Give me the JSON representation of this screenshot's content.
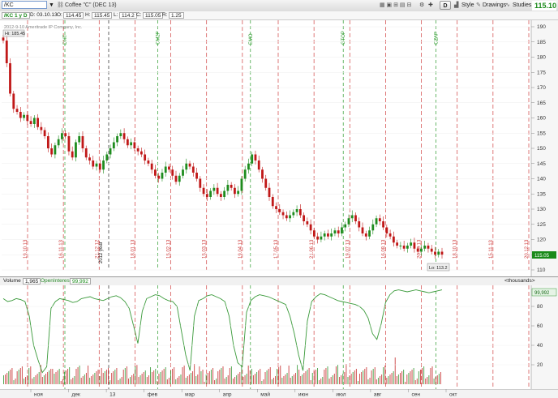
{
  "toolbar": {
    "symbol": "/KC",
    "instrument_name": "Coffee \"C\" (DEC 13)",
    "style_label": "Style",
    "drawings_label": "Drawings",
    "studies_label": "Studies",
    "d_label": "D",
    "last_price": "115.10"
  },
  "infobar": {
    "symbol_badge": "/KC 1 y D",
    "date": "D: 03.10.13",
    "o_label": "O:",
    "o_value": "114.45",
    "h_label": "H:",
    "h_value": "115.45",
    "l_label": "L:",
    "l_value": "114.2",
    "c_label": "C:",
    "c_value": "115.05",
    "r_label": "R:",
    "r_value": "1.25"
  },
  "price_chart": {
    "copyright": "2012-9-10 Ameritrade IP Company, Inc.",
    "high_label": "Hi: 185.45",
    "low_label": "Lo: 113.2",
    "last_label": "115.05",
    "year_marker": "2012 year",
    "y_ticks": [
      "190",
      "185",
      "180",
      "175",
      "170",
      "165",
      "160",
      "155",
      "150",
      "145",
      "140",
      "135",
      "130",
      "125",
      "120",
      "115",
      "110"
    ],
    "red_date_labels": [
      "19.10.13",
      "16.11.13",
      "21.12.12",
      "18.01.13",
      "15.02.13",
      "15.03.13",
      "19.04.13",
      "17.05.13",
      "21.06.13",
      "19.07.13",
      "16.08.13",
      "20.09.13",
      "18.10.13",
      "15.11.13",
      "20.12.13"
    ],
    "green_date_labels": [
      "DHT",
      "CM2P",
      "EMO",
      "GTOP",
      "CZAP"
    ]
  },
  "volume_panel": {
    "volume_label": "Volume",
    "volume_value": "1,965",
    "oi_label": "OpenInterest",
    "oi_value": "99,992",
    "units_label": "<thousands>",
    "oi_last": "99,992",
    "y_ticks": [
      "80",
      "60",
      "40",
      "20"
    ]
  },
  "x_axis": {
    "months": [
      "ноя",
      "дек",
      "13",
      "фев",
      "мар",
      "апр",
      "май",
      "июн",
      "июл",
      "авг",
      "сен",
      "окт"
    ]
  },
  "colors": {
    "up": "#1e8c1e",
    "down": "#c01818",
    "oi_line": "#3a9a3a",
    "red_grid": "#d04040",
    "green_grid": "#2a9a2a",
    "last_badge": "#1a8a1a"
  },
  "chart_data": {
    "type": "candlestick",
    "price_series": [
      185.45,
      178,
      168,
      163,
      162,
      160,
      161,
      159,
      158,
      160,
      157,
      156,
      154,
      150,
      148,
      151,
      153,
      155,
      154,
      149,
      147,
      152,
      154,
      150,
      147,
      146,
      144,
      145,
      143,
      146,
      148,
      150,
      152,
      154,
      155,
      153,
      151,
      152,
      150,
      149,
      148,
      146,
      145,
      143,
      141,
      140,
      142,
      144,
      143,
      141,
      139,
      141,
      143,
      145,
      144,
      142,
      140,
      137,
      135,
      134,
      136,
      137,
      135,
      134,
      136,
      138,
      137,
      135,
      136,
      140,
      143,
      145,
      148,
      146,
      143,
      140,
      137,
      134,
      131,
      130,
      129,
      128,
      127,
      128,
      129,
      130,
      128,
      126,
      125,
      123,
      121,
      120,
      121,
      122,
      121,
      122,
      123,
      122,
      124,
      125,
      127,
      128,
      126,
      124,
      122,
      121,
      123,
      125,
      127,
      126,
      124,
      122,
      121,
      119,
      118,
      118,
      117,
      118,
      119,
      117,
      116,
      117,
      118,
      117,
      116,
      115,
      116,
      115.05
    ],
    "oi_series": [
      88,
      85,
      86,
      88,
      87,
      85,
      70,
      40,
      25,
      12,
      18,
      78,
      85,
      88,
      87,
      86,
      84,
      85,
      88,
      89,
      90,
      88,
      87,
      86,
      88,
      90,
      91,
      89,
      85,
      78,
      60,
      42,
      75,
      88,
      90,
      92,
      91,
      88,
      86,
      85,
      80,
      55,
      30,
      14,
      70,
      86,
      88,
      91,
      92,
      90,
      88,
      85,
      70,
      40,
      22,
      18,
      74,
      86,
      90,
      92,
      91,
      90,
      88,
      86,
      84,
      82,
      70,
      52,
      30,
      14,
      65,
      85,
      90,
      93,
      92,
      90,
      88,
      86,
      85,
      84,
      83,
      82,
      80,
      76,
      68,
      52,
      46,
      62,
      84,
      92,
      96,
      97,
      96,
      95,
      96,
      97,
      96,
      95,
      94,
      95,
      96,
      97
    ],
    "oi_last": 99.992,
    "volume_last": 1.965,
    "y_range": [
      110,
      190
    ],
    "volume_y_range": [
      0,
      100
    ],
    "x_categories": [
      "ноя",
      "дек",
      "13",
      "фев",
      "мар",
      "апр",
      "май",
      "июн",
      "июл",
      "авг",
      "сен",
      "окт"
    ],
    "high": 185.45,
    "low": 113.2,
    "last": 115.05
  }
}
